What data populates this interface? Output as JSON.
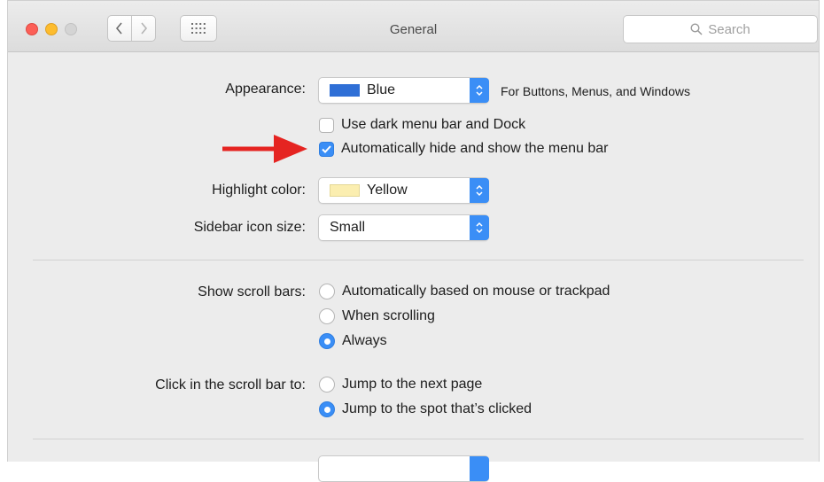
{
  "window": {
    "title": "General"
  },
  "search": {
    "placeholder": "Search"
  },
  "appearance": {
    "label": "Appearance:",
    "value": "Blue",
    "swatch_color": "#2f6fd6",
    "note": "For Buttons, Menus, and Windows"
  },
  "menu_bar": {
    "dark_label": "Use dark menu bar and Dock",
    "dark_checked": false,
    "autohide_label": "Automatically hide and show the menu bar",
    "autohide_checked": true
  },
  "highlight": {
    "label": "Highlight color:",
    "value": "Yellow",
    "swatch_color": "#fbeeb0"
  },
  "sidebar_icon": {
    "label": "Sidebar icon size:",
    "value": "Small"
  },
  "scroll_bars": {
    "label": "Show scroll bars:",
    "options": [
      "Automatically based on mouse or trackpad",
      "When scrolling",
      "Always"
    ],
    "selected": 2
  },
  "click_scroll": {
    "label": "Click in the scroll bar to:",
    "options": [
      "Jump to the next page",
      "Jump to the spot that’s clicked"
    ],
    "selected": 1
  },
  "colors": {
    "accent": "#3a8ef6",
    "annotation_arrow": "#e52421"
  },
  "icons": [
    "back-icon",
    "forward-icon",
    "grid-icon",
    "search-icon",
    "checkmark-icon",
    "red-arrow-annotation"
  ]
}
